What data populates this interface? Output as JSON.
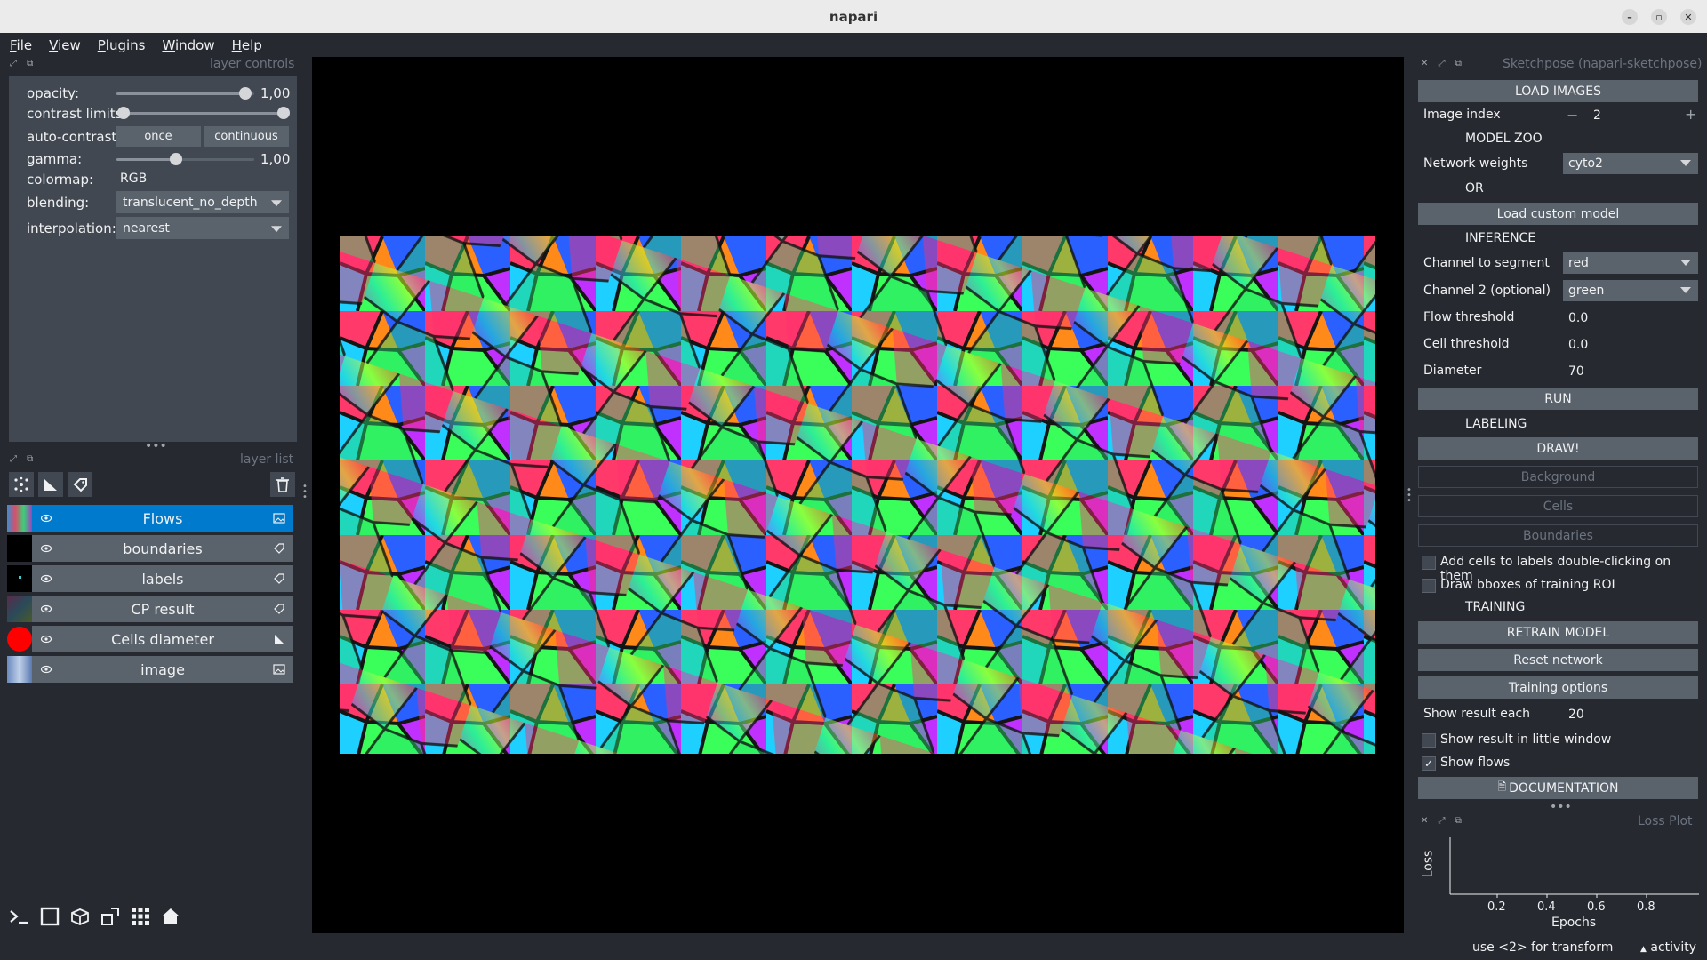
{
  "window": {
    "title": "napari"
  },
  "menu": [
    {
      "u": "F",
      "rest": "ile"
    },
    {
      "u": "V",
      "rest": "iew"
    },
    {
      "u": "P",
      "rest": "lugins"
    },
    {
      "u": "W",
      "rest": "indow"
    },
    {
      "u": "H",
      "rest": "elp"
    }
  ],
  "layer_controls": {
    "title": "layer controls",
    "opacity_label": "opacity:",
    "opacity_value": "1,00",
    "contrast_label": "contrast limits:",
    "autocontrast_label": "auto-contrast:",
    "once_label": "once",
    "continuous_label": "continuous",
    "gamma_label": "gamma:",
    "gamma_value": "1,00",
    "colormap_label": "colormap:",
    "colormap_value": "RGB",
    "blending_label": "blending:",
    "blending_value": "translucent_no_depth",
    "interpolation_label": "interpolation:",
    "interpolation_value": "nearest"
  },
  "layer_list": {
    "title": "layer list",
    "layers": [
      {
        "name": "Flows",
        "selected": true,
        "type": "image"
      },
      {
        "name": "boundaries",
        "selected": false,
        "type": "labels"
      },
      {
        "name": "labels",
        "selected": false,
        "type": "labels"
      },
      {
        "name": "CP result",
        "selected": false,
        "type": "labels"
      },
      {
        "name": "Cells diameter",
        "selected": false,
        "type": "shapes"
      },
      {
        "name": "image",
        "selected": false,
        "type": "image"
      }
    ]
  },
  "sketchpose": {
    "title": "Sketchpose (napari-sketchpose)",
    "load_images": "LOAD IMAGES",
    "image_index_label": "Image index",
    "image_index_value": "2",
    "model_zoo": "MODEL ZOO",
    "network_weights_label": "Network weights",
    "network_weights_value": "cyto2",
    "or_label": "OR",
    "load_custom_model": "Load custom model",
    "inference": "INFERENCE",
    "channel_segment_label": "Channel to segment",
    "channel_segment_value": "red",
    "channel2_label": "Channel 2 (optional)",
    "channel2_value": "green",
    "flow_threshold_label": "Flow threshold",
    "flow_threshold_value": "0.0",
    "cell_threshold_label": "Cell threshold",
    "cell_threshold_value": "0.0",
    "diameter_label": "Diameter",
    "diameter_value": "70",
    "run": "RUN",
    "labeling": "LABELING",
    "draw": "DRAW!",
    "background": "Background",
    "cells": "Cells",
    "boundaries": "Boundaries",
    "add_cells_label": "Add cells to labels double-clicking on them",
    "draw_bboxes_label": "Draw bboxes of training ROI",
    "training": "TRAINING",
    "retrain_model": "RETRAIN MODEL",
    "reset_network": "Reset network",
    "training_options": "Training options",
    "show_result_each_label": "Show result each",
    "show_result_each_value": "20",
    "show_little_window_label": "Show result in little window",
    "show_flows_label": "Show flows",
    "show_flows_checked": true,
    "documentation": "DOCUMENTATION"
  },
  "loss_plot": {
    "title": "Loss Plot",
    "ylabel": "Loss",
    "xlabel": "Epochs",
    "xticks": [
      "0.2",
      "0.4",
      "0.6",
      "0.8"
    ]
  },
  "status": {
    "hint": "use <2> for transform",
    "activity": "activity"
  },
  "colors": {
    "background": "#262930",
    "panel": "#414851",
    "control": "#5a626c",
    "selection": "#007acc"
  }
}
